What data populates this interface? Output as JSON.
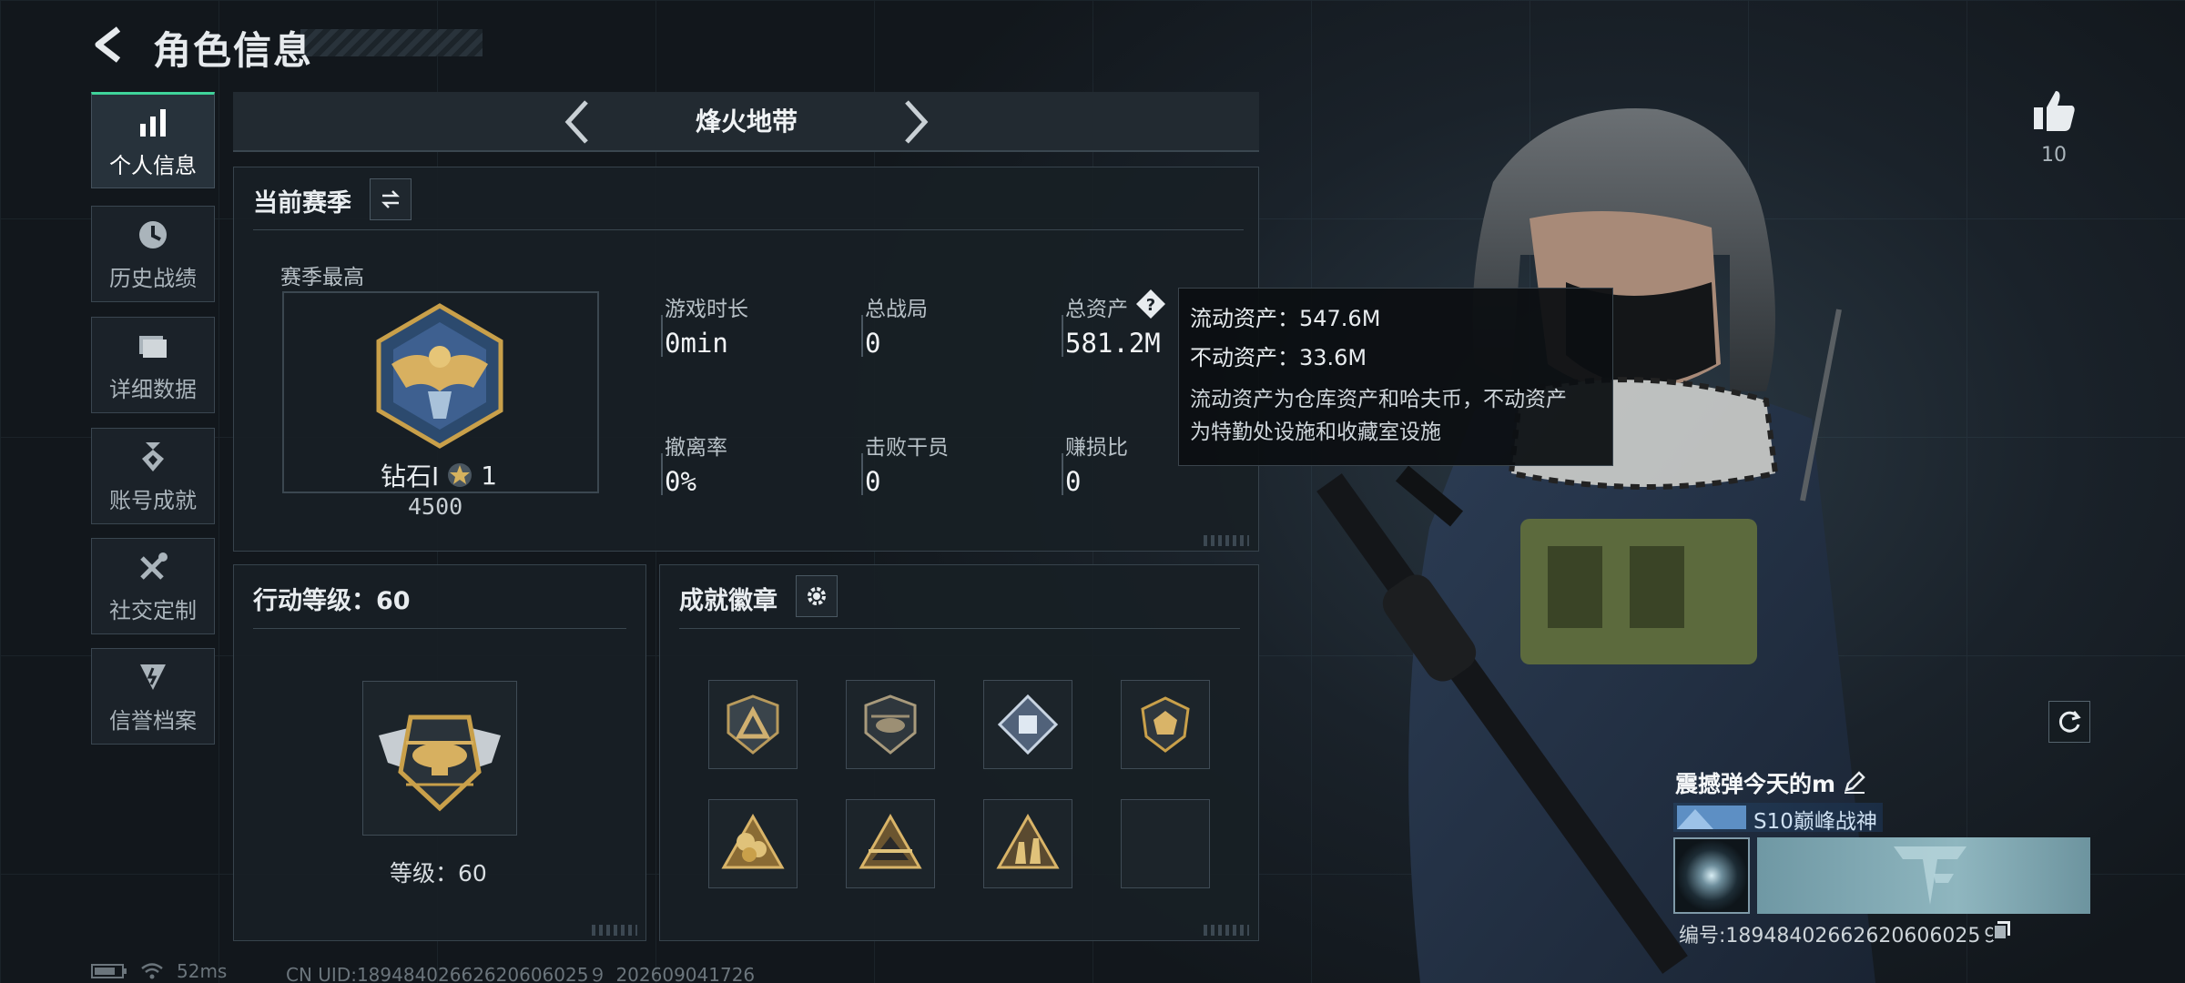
{
  "header": {
    "title": "角色信息"
  },
  "sidebar": {
    "items": [
      {
        "label": "个人信息",
        "icon": "bar-chart-icon",
        "active": true
      },
      {
        "label": "历史战绩",
        "icon": "clock-icon"
      },
      {
        "label": "详细数据",
        "icon": "folder-icon"
      },
      {
        "label": "账号成就",
        "icon": "medal-icon"
      },
      {
        "label": "社交定制",
        "icon": "wrench-icon"
      },
      {
        "label": "信誉档案",
        "icon": "shield-icon"
      }
    ]
  },
  "mode": {
    "title": "烽火地带"
  },
  "season": {
    "heading": "当前赛季",
    "best_label": "赛季最高",
    "rank_name": "钻石Ⅰ",
    "rank_stars": "1",
    "rank_points": "4500",
    "stats": [
      {
        "label": "游戏时长",
        "value": "0min"
      },
      {
        "label": "总战局",
        "value": "0"
      },
      {
        "label": "总资产",
        "value": "581.2M"
      },
      {
        "label": "撤离率",
        "value": "0%"
      },
      {
        "label": "击败干员",
        "value": "0"
      },
      {
        "label": "赚损比",
        "value": "0"
      }
    ]
  },
  "tooltip": {
    "line1": "流动资产：547.6M",
    "line2": "不动资产：33.6M",
    "desc1": "流动资产为仓库资产和哈夫币，不动资产",
    "desc2": "为特勤处设施和收藏室设施"
  },
  "action_level": {
    "heading": "行动等级：60",
    "level_text": "等级：60"
  },
  "achievements": {
    "heading": "成就徽章",
    "slot_count": 8,
    "filled": 7
  },
  "profile": {
    "likes": "10",
    "player_name": "震撼弹今天的m",
    "rank_title": "S10巅峰战神",
    "serial": "编号:18948402662620606025９"
  },
  "status": {
    "ping": "52ms",
    "uid": "CN UID:18948402662620606025９_202609041726"
  },
  "colors": {
    "accent": "#3fd49a",
    "gold": "#c9a04a",
    "panel": "#1b2229"
  }
}
